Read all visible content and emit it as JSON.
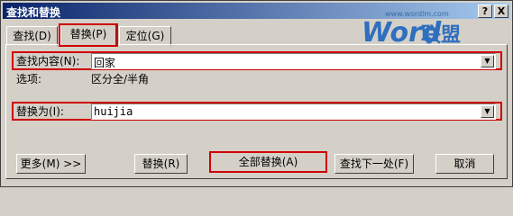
{
  "window": {
    "title": "查找和替换"
  },
  "titlebar": {
    "help_label": "?",
    "close_label": "X"
  },
  "watermark": {
    "brand_latin": "Word",
    "brand_cn": "联盟",
    "url": "www.wordlm.com"
  },
  "tabs": [
    {
      "label": "查找(D)"
    },
    {
      "label": "替换(P)"
    },
    {
      "label": "定位(G)"
    }
  ],
  "find": {
    "label": "查找内容(N):",
    "value": "回家"
  },
  "options": {
    "label": "选项:",
    "value": "区分全/半角"
  },
  "replace": {
    "label": "替换为(I):",
    "value": "huijia"
  },
  "buttons": {
    "more": "更多(M) >>",
    "replace": "替换(R)",
    "replace_all": "全部替换(A)",
    "find_next": "查找下一处(F)",
    "cancel": "取消"
  },
  "colors": {
    "highlight": "#d00000",
    "titlebar_start": "#0a246a",
    "titlebar_end": "#a6caf0"
  },
  "icons": {
    "dropdown": "chevron-down-icon",
    "help": "help-icon",
    "close": "close-icon"
  }
}
